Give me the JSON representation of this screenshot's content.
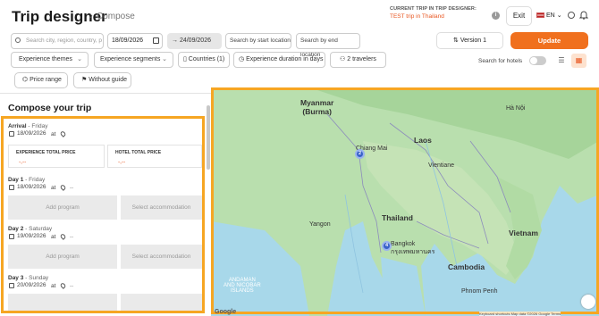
{
  "header": {
    "title": "Trip designer",
    "breadcrumb_sep": "›",
    "breadcrumb": "Compose",
    "current_trip_label": "CURRENT TRIP IN TRIP DESIGNER:",
    "current_trip_value": "TEST trip in Thailand",
    "info_icon": "i",
    "exit_label": "Exit",
    "language": "EN",
    "chevron": "⌄"
  },
  "filters": {
    "search_placeholder": "Search city, region, country, p",
    "date_from": "18/09/2026",
    "date_to": "→ 24/09/2026",
    "start_location": "Search by start location",
    "end_location": "Search by end location",
    "version": "Version 1",
    "update": "Update",
    "experience_themes": "Experience themes",
    "experience_segments": "Experience segments",
    "countries": "Countries (1)",
    "duration": "Experience duration in days",
    "travelers": "2 travelers",
    "search_hotels": "Search for hotels",
    "price_range": "Price range",
    "without_guide": "Without guide"
  },
  "compose": {
    "title": "Compose your trip",
    "arrival": {
      "title": "Arrival",
      "weekday": "Friday",
      "date": "18/09/2026",
      "at": "at"
    },
    "experience_total_label": "EXPERIENCE TOTAL PRICE",
    "experience_total_value": "-,--",
    "hotel_total_label": "HOTEL TOTAL PRICE",
    "hotel_total_value": "-,--",
    "days": [
      {
        "title": "Day 1",
        "weekday": "Friday",
        "date": "18/09/2026",
        "at": "at",
        "dash": "--",
        "add_program": "Add program",
        "select_accommodation": "Select accommodation"
      },
      {
        "title": "Day 2",
        "weekday": "Saturday",
        "date": "19/09/2026",
        "at": "at",
        "dash": "--",
        "add_program": "Add program",
        "select_accommodation": "Select accommodation"
      },
      {
        "title": "Day 3",
        "weekday": "Sunday",
        "date": "20/09/2026",
        "at": "at",
        "dash": "--"
      }
    ]
  },
  "map": {
    "labels": {
      "myanmar": "Myanmar\n(Burma)",
      "laos": "Laos",
      "thailand": "Thailand",
      "vietnam": "Vietnam",
      "cambodia": "Cambodia",
      "bangkok": "Bangkok\nกรุงเทพมหานคร",
      "vientiane": "Vientiane",
      "andaman": "ANDAMAN\nAND NICOBAR\nISLANDS",
      "chiang_mai": "Chiang Mai",
      "yangon": "Yangon",
      "hanoi": "Hà Nội",
      "phnom_penh": "Phnom Penh"
    },
    "clusters": [
      "2",
      "4"
    ],
    "google": "Google",
    "attribution": "Keyboard shortcuts   Map data ©2026 Google   Terms"
  },
  "colors": {
    "accent": "#f0701e",
    "highlight": "#f6a623",
    "price": "#e8551f",
    "cluster": "#3a63c9"
  }
}
